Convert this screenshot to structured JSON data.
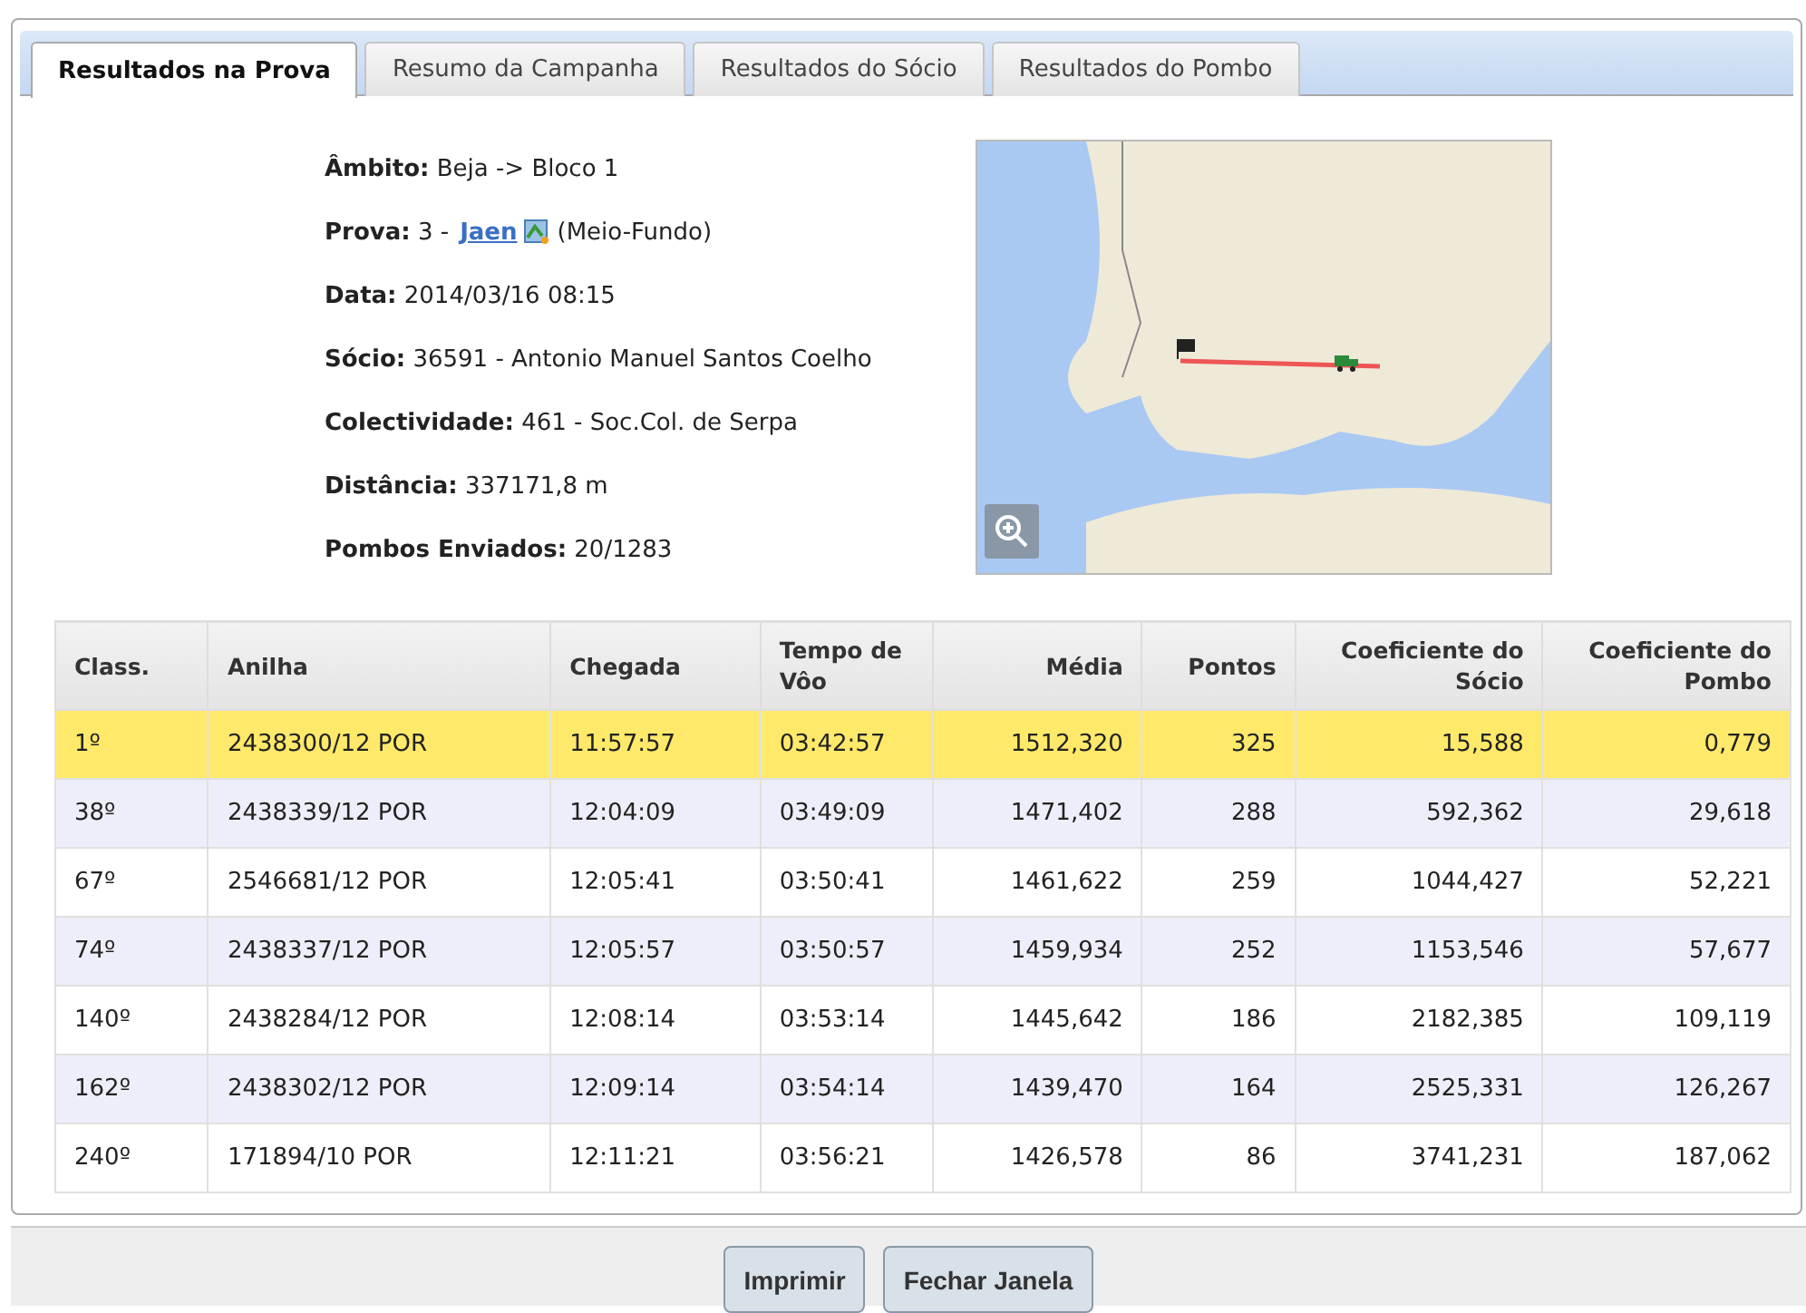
{
  "tabs": [
    {
      "label": "Resultados na Prova",
      "selected": true
    },
    {
      "label": "Resumo da Campanha",
      "selected": false
    },
    {
      "label": "Resultados do Sócio",
      "selected": false
    },
    {
      "label": "Resultados do Pombo",
      "selected": false
    }
  ],
  "details": [
    {
      "kind": "text",
      "label": "Âmbito:",
      "value": "Beja -> Bloco 1"
    },
    {
      "kind": "link",
      "label": "Prova:",
      "value": "3 -",
      "link": "Jaen",
      "suffix": "(Meio-Fundo)"
    },
    {
      "kind": "text",
      "label": "Data:",
      "value": "2014/03/16 08:15"
    },
    {
      "kind": "text",
      "label": "Sócio:",
      "value": "36591 - Antonio Manuel Santos Coelho"
    },
    {
      "kind": "text",
      "label": "Colectividade:",
      "value": "461 - Soc.Col. de Serpa"
    },
    {
      "kind": "text",
      "label": "Distância:",
      "value": "337171,8 m"
    },
    {
      "kind": "text",
      "label": "Pombos Enviados:",
      "value": "20/1283"
    }
  ],
  "table": {
    "columns": [
      "Class.",
      "Anilha",
      "Chegada",
      "Tempo de Vôo",
      "Média",
      "Pontos",
      "Coeficiente do Sócio",
      "Coeficiente do Pombo"
    ],
    "rows": [
      {
        "selected": true,
        "cells": [
          "1º",
          "2438300/12 POR",
          "11:57:57",
          "03:42:57",
          "1512,320",
          "325",
          "15,588",
          "0,779"
        ]
      },
      {
        "selected": false,
        "cells": [
          "38º",
          "2438339/12 POR",
          "12:04:09",
          "03:49:09",
          "1471,402",
          "288",
          "592,362",
          "29,618"
        ]
      },
      {
        "selected": false,
        "cells": [
          "67º",
          "2546681/12 POR",
          "12:05:41",
          "03:50:41",
          "1461,622",
          "259",
          "1044,427",
          "52,221"
        ]
      },
      {
        "selected": false,
        "cells": [
          "74º",
          "2438337/12 POR",
          "12:05:57",
          "03:50:57",
          "1459,934",
          "252",
          "1153,546",
          "57,677"
        ]
      },
      {
        "selected": false,
        "cells": [
          "140º",
          "2438284/12 POR",
          "12:08:14",
          "03:53:14",
          "1445,642",
          "186",
          "2182,385",
          "109,119"
        ]
      },
      {
        "selected": false,
        "cells": [
          "162º",
          "2438302/12 POR",
          "12:09:14",
          "03:54:14",
          "1439,470",
          "164",
          "2525,331",
          "126,267"
        ]
      },
      {
        "selected": false,
        "cells": [
          "240º",
          "171894/10 POR",
          "12:11:21",
          "03:56:21",
          "1426,578",
          "86",
          "3741,231",
          "187,062"
        ]
      }
    ]
  },
  "buttons": [
    "Imprimir",
    "Fechar Janela"
  ]
}
